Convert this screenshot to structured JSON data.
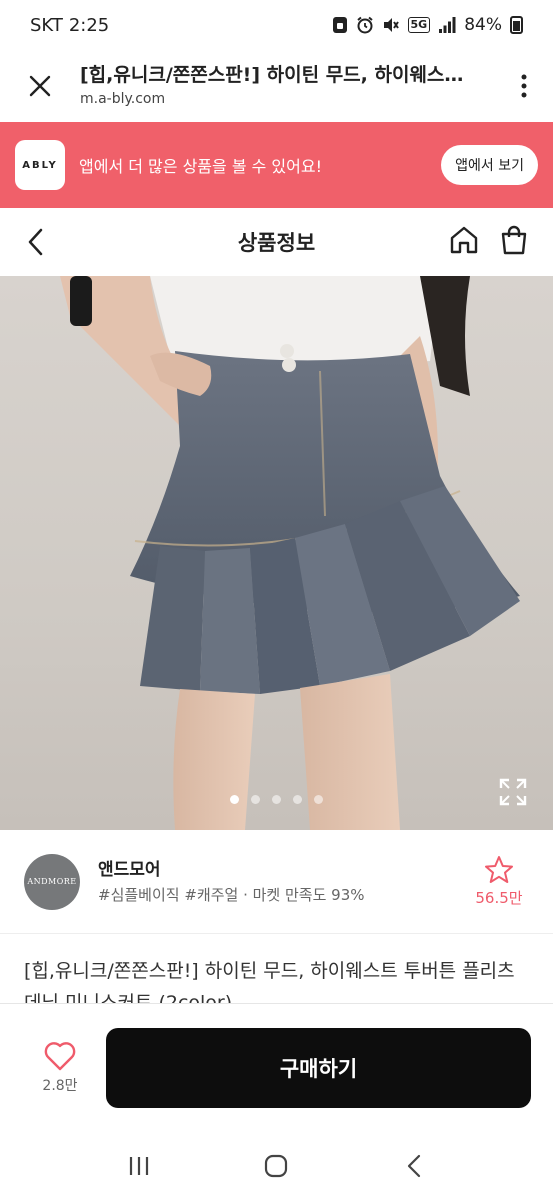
{
  "status_bar": {
    "carrier": "SKT",
    "time": "2:25",
    "network": "5G",
    "battery": "84%"
  },
  "browser": {
    "page_title": "[힙,유니크/쫀쫀스판!] 하이틴 무드, 하이웨스…",
    "url": "m.a-bly.com"
  },
  "app_banner": {
    "logo_text": "ABLY",
    "message": "앱에서 더 많은 상품을 볼 수 있어요!",
    "button_label": "앱에서 보기"
  },
  "header": {
    "title": "상품정보"
  },
  "gallery": {
    "image_count": 5,
    "active_index": 0
  },
  "shop": {
    "avatar_text": "ANDMORE",
    "name": "앤드모어",
    "tags": "#심플베이직 #캐주얼 · 마켓 만족도 93%",
    "favorite_count": "56.5만"
  },
  "product": {
    "title": "[힙,유니크/쫀쫀스판!] 하이틴 무드, 하이웨스트 투버튼 플리츠 데님 미니스커트 (2color)"
  },
  "action_bar": {
    "like_count": "2.8만",
    "buy_label": "구매하기"
  },
  "colors": {
    "banner": "#f0606a",
    "accent_pink": "#ef5b6b",
    "buy_button": "#0d0d0d"
  }
}
